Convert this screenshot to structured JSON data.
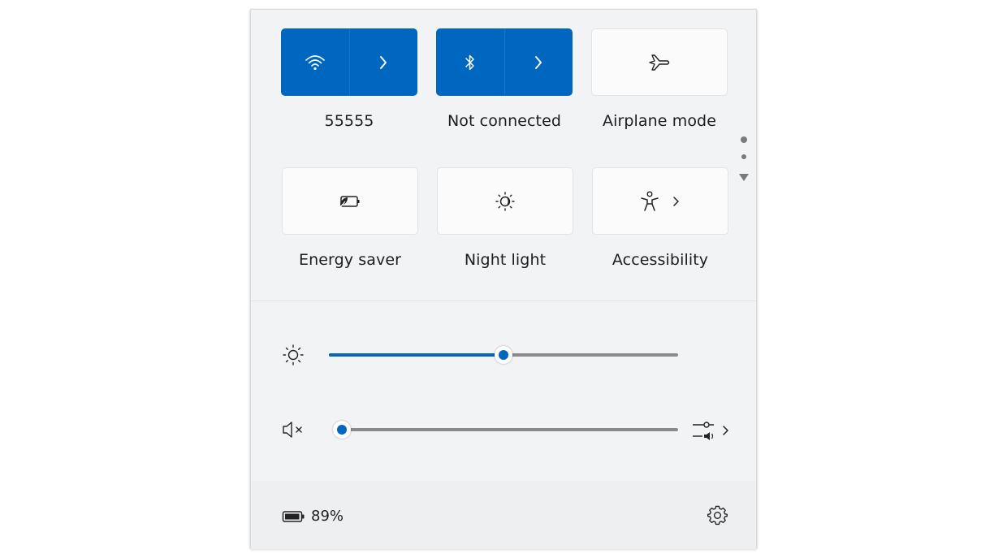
{
  "tiles": [
    {
      "label": "55555",
      "icon": "wifi-icon",
      "active": true,
      "split": true
    },
    {
      "label": "Not connected",
      "icon": "bluetooth-icon",
      "active": true,
      "split": true
    },
    {
      "label": "Airplane mode",
      "icon": "airplane-icon",
      "active": false,
      "split": false
    },
    {
      "label": "Energy saver",
      "icon": "energy-saver-icon",
      "active": false,
      "split": false
    },
    {
      "label": "Night light",
      "icon": "night-light-icon",
      "active": false,
      "split": false
    },
    {
      "label": "Accessibility",
      "icon": "accessibility-icon",
      "active": false,
      "split": false
    }
  ],
  "sliders": {
    "brightness": {
      "icon": "brightness-icon",
      "value_percent": 50
    },
    "volume": {
      "icon": "volume-muted-icon",
      "value_percent": 0,
      "device_icon": "audio-output-icon"
    }
  },
  "footer": {
    "battery_text": "89%",
    "battery_icon": "battery-icon",
    "settings_icon": "gear-icon"
  },
  "colors": {
    "accent": "#0067c0",
    "panel_bg": "#f2f3f5",
    "tile_bg": "#fbfbfb",
    "text": "#1d1d1d"
  }
}
